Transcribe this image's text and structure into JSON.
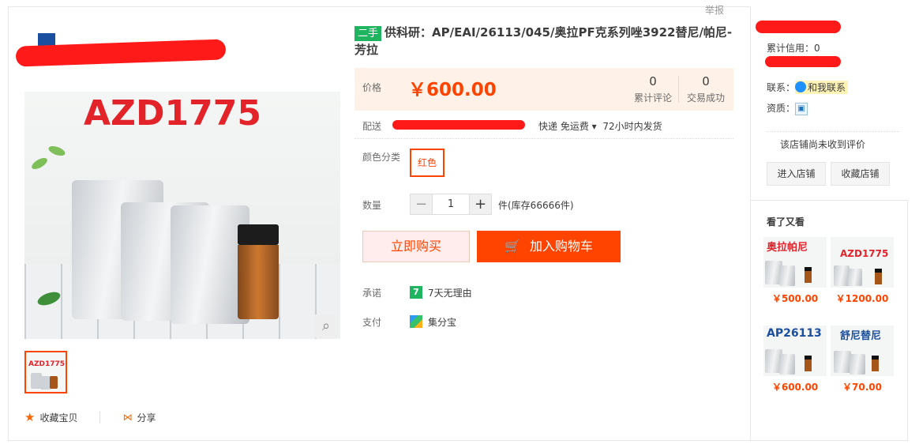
{
  "header": {
    "report_label": "举报"
  },
  "gallery": {
    "main_image_title": "AZD1775",
    "thumbnail_title": "AZD1775"
  },
  "actions": {
    "favorite_label": "收藏宝贝",
    "share_label": "分享"
  },
  "product": {
    "tag": "二手",
    "title": "供科研：AP/EAI/26113/045/奥拉PF克系列唑3922替尼/帕尼-芳拉",
    "price_label": "价格",
    "price": "￥600.00",
    "reviews_count": "0",
    "reviews_label": "累计评论",
    "deals_count": "0",
    "deals_label": "交易成功",
    "delivery_label": "配送",
    "shipping_method": "快递 免运费",
    "ship_time": "72小时内发货",
    "color_label": "颜色分类",
    "color_option": "红色",
    "quantity_label": "数量",
    "quantity_value": "1",
    "stock": "件(库存66666件)",
    "buy_now_label": "立即购买",
    "add_cart_label": "加入购物车",
    "promise_label": "承诺",
    "promise_value": "7天无理由",
    "payment_label": "支付",
    "payment_value": "集分宝"
  },
  "shop": {
    "credit_label": "累计信用：0",
    "contact_label": "联系：",
    "contact_button": "和我联系",
    "qualification_label": "资质：",
    "no_reviews": "该店铺尚未收到评价",
    "enter_shop": "进入店铺",
    "favorite_shop": "收藏店铺"
  },
  "recommendations": {
    "title": "看了又看",
    "items": [
      {
        "name": "奥拉帕尼",
        "price": "￥500.00"
      },
      {
        "name": "AZD1775",
        "price": "￥1200.00"
      },
      {
        "name": "AP26113",
        "price": "￥600.00"
      },
      {
        "name": "舒尼替尼",
        "price": "￥70.00"
      }
    ]
  },
  "colors": {
    "accent": "#ff4400",
    "price": "#ff4400",
    "tag_green": "#1fb460"
  }
}
